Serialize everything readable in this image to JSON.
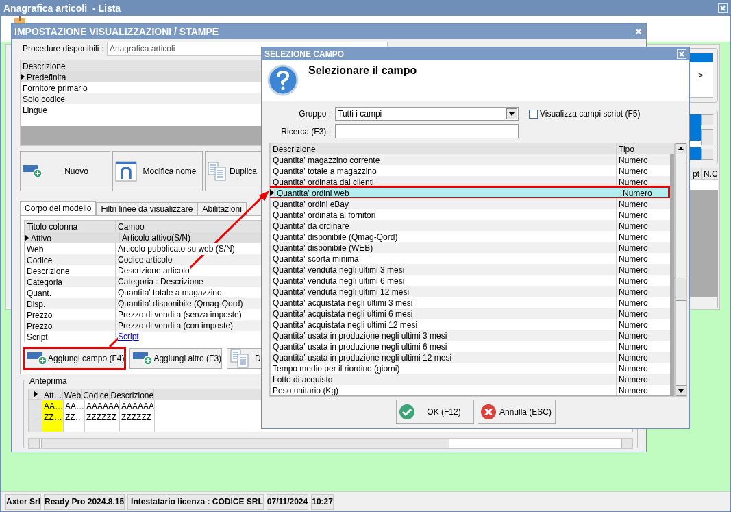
{
  "main_window": {
    "title": "Anagrafica articoli  - Lista",
    "background_labels": [
      ">",
      "pt",
      "N.C"
    ]
  },
  "settings_dialog": {
    "title": "IMPOSTAZIONE VISUALIZZAZIONI / STAMPE",
    "procedure_label": "Procedure disponibili :",
    "procedure_value": "Anagrafica articoli",
    "views": {
      "column": "Descrizione",
      "rows": [
        {
          "label": "Predefinita",
          "selected": true
        },
        {
          "label": "Fornitore primario",
          "selected": false
        },
        {
          "label": "Solo codice",
          "selected": false
        },
        {
          "label": "Lingue",
          "selected": false
        }
      ]
    },
    "buttons": [
      {
        "label": "Nuovo"
      },
      {
        "label": "Modifica nome"
      },
      {
        "label": "Duplica"
      }
    ],
    "tabs": [
      {
        "label": "Corpo del modello",
        "selected": true
      },
      {
        "label": "Filtri linee da visualizzare",
        "selected": false
      },
      {
        "label": "Abilitazioni",
        "selected": false
      }
    ],
    "fields": {
      "columns": [
        "Titolo colonna",
        "Campo"
      ],
      "rows": [
        {
          "title": "Attivo",
          "field": "Articolo attivo(S/N)",
          "kind": "text",
          "selected": true
        },
        {
          "title": "Web",
          "field": "Articolo pubblicato su web (S/N)",
          "kind": "text",
          "selected": false
        },
        {
          "title": "Codice",
          "field": "Codice articolo",
          "kind": "text",
          "selected": false
        },
        {
          "title": "Descrizione",
          "field": "Descrizione articolo",
          "kind": "text",
          "selected": false
        },
        {
          "title": "Categoria",
          "field": "Categoria : Descrizione",
          "kind": "text",
          "selected": false
        },
        {
          "title": "Quant.",
          "field": "Quantita' totale a magazzino",
          "kind": "text",
          "selected": false
        },
        {
          "title": "Disp.",
          "field": "Quantita' disponibile (Qmag-Qord)",
          "kind": "text",
          "selected": false
        },
        {
          "title": "Prezzo",
          "field": "Prezzo di vendita (senza imposte)",
          "kind": "text",
          "selected": false
        },
        {
          "title": "Prezzo",
          "field": "Prezzo di vendita (con imposte)",
          "kind": "text",
          "selected": false
        },
        {
          "title": "Script",
          "field": "Script",
          "kind": "link",
          "selected": false
        }
      ]
    },
    "action_buttons": [
      {
        "label": "Aggiungi campo (F4)",
        "highlighted": true
      },
      {
        "label": "Aggiungi altro (F3)",
        "highlighted": false
      },
      {
        "label": "D",
        "highlighted": false
      }
    ],
    "preview": {
      "title": "Anteprima",
      "columns": [
        {
          "label": "Att…",
          "highlighted": true
        },
        {
          "label": "Web",
          "highlighted": false
        },
        {
          "label": "Codice",
          "highlighted": false
        },
        {
          "label": "Descrizione",
          "highlighted": false
        }
      ],
      "rows": [
        [
          "AA…",
          "AA…",
          "AAAAAA",
          "AAAAAA"
        ],
        [
          "ZZ…",
          "ZZ…",
          "ZZZZZZ",
          "ZZZZZZ"
        ]
      ]
    }
  },
  "field_dialog": {
    "title": "SELEZIONE CAMPO",
    "heading": "Selezionare il campo",
    "group_label": "Gruppo :",
    "group_value": "Tutti i campi",
    "search_label": "Ricerca (F3) :",
    "script_checkbox": {
      "label": "Visualizza campi script (F5)",
      "checked": false
    },
    "columns": [
      "Descrizione",
      "Tipo"
    ],
    "rows": [
      {
        "description": "Quantita' magazzino corrente",
        "type": "Numero",
        "selected": false,
        "highlighted": false
      },
      {
        "description": "Quantita' totale a magazzino",
        "type": "Numero",
        "selected": false,
        "highlighted": false
      },
      {
        "description": "Quantita' ordinata dai clienti",
        "type": "Numero",
        "selected": false,
        "highlighted": false
      },
      {
        "description": "Quantita' ordini web",
        "type": "Numero",
        "selected": true,
        "highlighted": true
      },
      {
        "description": "Quantita' ordini eBay",
        "type": "Numero",
        "selected": false,
        "highlighted": false
      },
      {
        "description": "Quantita' ordinata ai fornitori",
        "type": "Numero",
        "selected": false,
        "highlighted": false
      },
      {
        "description": "Quantita' da ordinare",
        "type": "Numero",
        "selected": false,
        "highlighted": false
      },
      {
        "description": "Quantita' disponibile (Qmag-Qord)",
        "type": "Numero",
        "selected": false,
        "highlighted": false
      },
      {
        "description": "Quantita' disponibile (WEB)",
        "type": "Numero",
        "selected": false,
        "highlighted": false
      },
      {
        "description": "Quantita' scorta minima",
        "type": "Numero",
        "selected": false,
        "highlighted": false
      },
      {
        "description": "Quantita' venduta negli ultimi 3 mesi",
        "type": "Numero",
        "selected": false,
        "highlighted": false
      },
      {
        "description": "Quantita' venduta negli ultimi 6 mesi",
        "type": "Numero",
        "selected": false,
        "highlighted": false
      },
      {
        "description": "Quantita' venduta negli ultimi 12 mesi",
        "type": "Numero",
        "selected": false,
        "highlighted": false
      },
      {
        "description": "Quantita' acquistata negli ultimi 3 mesi",
        "type": "Numero",
        "selected": false,
        "highlighted": false
      },
      {
        "description": "Quantita' acquistata negli ultimi 6 mesi",
        "type": "Numero",
        "selected": false,
        "highlighted": false
      },
      {
        "description": "Quantita' acquistata negli ultimi 12 mesi",
        "type": "Numero",
        "selected": false,
        "highlighted": false
      },
      {
        "description": "Quantita' usata in produzione negli ultimi 3 mesi",
        "type": "Numero",
        "selected": false,
        "highlighted": false
      },
      {
        "description": "Quantita' usata in produzione negli ultimi 6 mesi",
        "type": "Numero",
        "selected": false,
        "highlighted": false
      },
      {
        "description": "Quantita' usata in produzione negli ultimi 12 mesi",
        "type": "Numero",
        "selected": false,
        "highlighted": false
      },
      {
        "description": "Tempo medio per il riordino (giorni)",
        "type": "Numero",
        "selected": false,
        "highlighted": false
      },
      {
        "description": "Lotto di acquisto",
        "type": "Numero",
        "selected": false,
        "highlighted": false
      },
      {
        "description": "Peso unitario (Kg)",
        "type": "Numero",
        "selected": false,
        "highlighted": false
      }
    ],
    "buttons": [
      {
        "label": "OK (F12)",
        "kind": "ok"
      },
      {
        "label": "Annulla (ESC)",
        "kind": "cancel"
      }
    ]
  },
  "status_bar": [
    "Axter Srl",
    "Ready Pro 2024.8.15",
    "Intestatario licenza : CODICE SRL",
    "07/11/2024",
    "10:27"
  ]
}
